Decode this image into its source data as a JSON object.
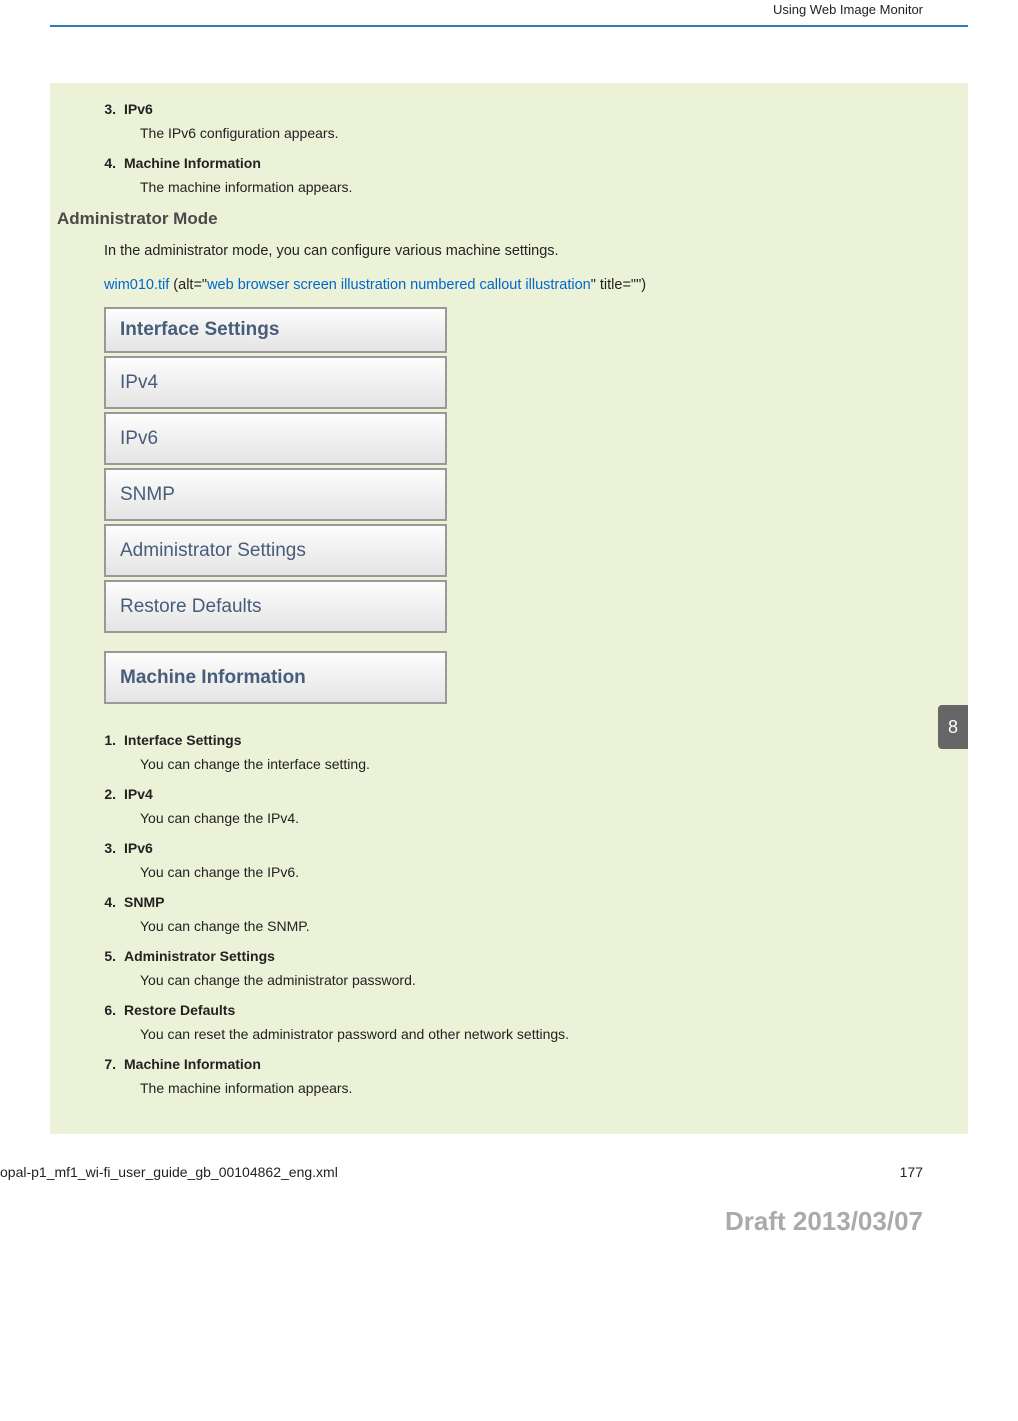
{
  "header": {
    "running_title": "Using Web Image Monitor"
  },
  "top_list": [
    {
      "num": "3.",
      "title": "IPv6",
      "desc": "The IPv6 configuration appears."
    },
    {
      "num": "4.",
      "title": "Machine Information",
      "desc": "The machine information appears."
    }
  ],
  "section": {
    "heading": "Administrator Mode",
    "intro": "In the administrator mode, you can configure various machine settings.",
    "image_ref": {
      "filename": "wim010.tif",
      "prefix": " (alt=\"",
      "alt": "web browser screen illustration numbered callout illustration",
      "suffix": "\" title=\"\")"
    }
  },
  "ui_menu": {
    "header": "Interface Settings",
    "items": [
      "IPv4",
      "IPv6",
      "SNMP",
      "Administrator Settings",
      "Restore Defaults"
    ],
    "section2": "Machine Information"
  },
  "admin_list": [
    {
      "num": "1.",
      "title": "Interface Settings",
      "desc": "You can change the interface setting."
    },
    {
      "num": "2.",
      "title": "IPv4",
      "desc": "You can change the IPv4."
    },
    {
      "num": "3.",
      "title": "IPv6",
      "desc": "You can change the IPv6."
    },
    {
      "num": "4.",
      "title": "SNMP",
      "desc": "You can change the SNMP."
    },
    {
      "num": "5.",
      "title": "Administrator Settings",
      "desc": "You can change the administrator password."
    },
    {
      "num": "6.",
      "title": "Restore Defaults",
      "desc": "You can reset the administrator password and other network settings."
    },
    {
      "num": "7.",
      "title": "Machine Information",
      "desc": "The machine information appears."
    }
  ],
  "chapter_tab": "8",
  "footer": {
    "left": "opal-p1_mf1_wi-fi_user_guide_gb_00104862_eng.xml",
    "right": "177"
  },
  "draft": "Draft 2013/03/07"
}
